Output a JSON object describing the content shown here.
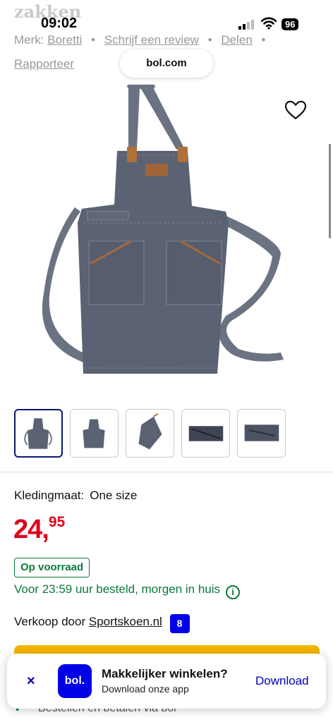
{
  "status_bar": {
    "background_title": "zakken",
    "time": "09:02",
    "battery": "96"
  },
  "meta": {
    "brand_label": "Merk:",
    "brand": "Boretti",
    "review_link": "Schrijf een review",
    "share_link": "Delen",
    "report_link": "Rapporteer",
    "separator": "•"
  },
  "browser": {
    "url": "bol.com"
  },
  "gallery": {
    "thumbnails": [
      {
        "name": "apron-front",
        "active": true
      },
      {
        "name": "apron-front-small",
        "active": false
      },
      {
        "name": "apron-hanging",
        "active": false
      },
      {
        "name": "apron-detail-1",
        "active": false
      },
      {
        "name": "apron-detail-2",
        "active": false
      }
    ],
    "icons": {
      "favorite": "heart-icon"
    }
  },
  "product": {
    "size_label": "Kledingmaat:",
    "size_value": "One size",
    "price_whole": "24,",
    "price_cents": "95",
    "stock": "Op voorraad",
    "delivery": "Voor 23:59 uur besteld, morgen in huis",
    "seller_label": "Verkoop door",
    "seller_name": "Sportskoen.nl",
    "seller_score": "8",
    "under_text": "Bestellen en betalen via bol"
  },
  "app_banner": {
    "close": "×",
    "logo": "bol.",
    "title": "Makkelijker winkelen?",
    "subtitle": "Download onze app",
    "download": "Download"
  },
  "colors": {
    "price": "#e0001b",
    "stock_green": "#0b7a3b",
    "bol_blue": "#0000e6",
    "cart_yellow": "#f5b400",
    "apron": "#5a6273"
  }
}
